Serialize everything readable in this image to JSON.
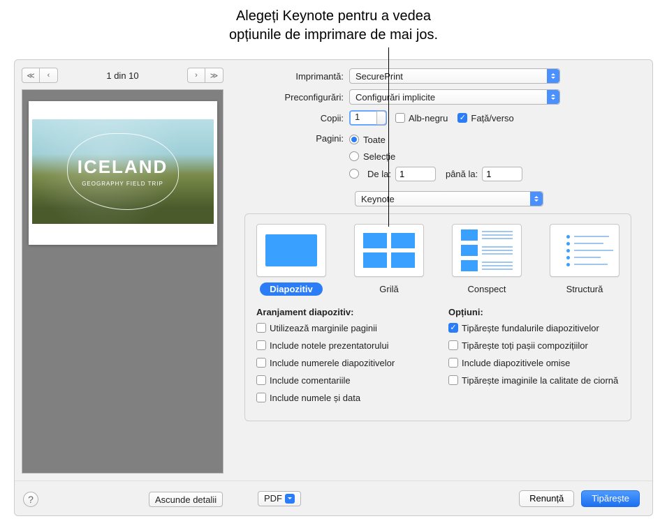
{
  "annotation": {
    "line1": "Alegeți Keynote pentru a vedea",
    "line2": "opțiunile de imprimare de mai jos."
  },
  "preview": {
    "page_indicator": "1 din 10",
    "slide_title": "ICELAND",
    "slide_subtitle": "GEOGRAPHY FIELD TRIP"
  },
  "labels": {
    "printer": "Imprimantă:",
    "presets": "Preconfigurări:",
    "copies": "Copii:",
    "bw": "Alb-negru",
    "twosided": "Față/verso",
    "pages": "Pagini:",
    "all": "Toate",
    "selection": "Selecție",
    "from": "De la:",
    "to": "până la:"
  },
  "values": {
    "printer": "SecurePrint",
    "presets": "Configurări implicite",
    "copies": "1",
    "from": "1",
    "to": "1",
    "section": "Keynote"
  },
  "checks": {
    "bw": false,
    "twosided": true
  },
  "layouts": {
    "slide": "Diapozitiv",
    "grid": "Grilă",
    "handout": "Conspect",
    "outline": "Structură"
  },
  "arrangement": {
    "heading": "Aranjament diapozitiv:",
    "opts": {
      "margins": "Utilizează marginile paginii",
      "notes": "Include notele prezentatorului",
      "numbers": "Include numerele diapozitivelor",
      "comments": "Include comentariile",
      "namedate": "Include numele și data"
    }
  },
  "options": {
    "heading": "Opțiuni:",
    "opts": {
      "backgrounds": "Tipărește fundalurile diapozitivelor",
      "builds": "Tipărește toți pașii compozițiilor",
      "skipped": "Include diapozitivele omise",
      "draft": "Tipărește imaginile la calitate de ciornă"
    },
    "checked": {
      "backgrounds": true
    }
  },
  "footer": {
    "pdf": "PDF",
    "hide_details": "Ascunde detalii",
    "cancel": "Renunță",
    "print": "Tipărește"
  }
}
